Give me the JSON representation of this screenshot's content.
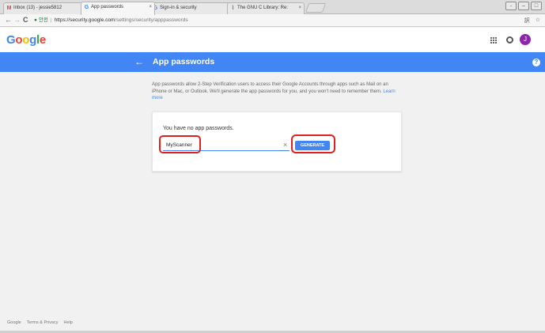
{
  "browser": {
    "tabs": [
      {
        "favicon": "M",
        "favicon_color": "#db4437",
        "title": "Inbox (13) - jessie5812",
        "active": false
      },
      {
        "favicon": "G",
        "favicon_color": "#4285f4",
        "title": "App passwords",
        "active": true
      },
      {
        "favicon": "G",
        "favicon_color": "#4285f4",
        "title": "Sign-in & security",
        "active": false
      },
      {
        "favicon": "⌇",
        "favicon_color": "#777777",
        "title": "The GNU C Library: Re:",
        "active": false
      }
    ],
    "tab_close": "×",
    "window_controls": [
      "˗",
      "–",
      "□"
    ],
    "nav": {
      "back": "←",
      "forward": "→",
      "reload": "C"
    },
    "address": {
      "secure_text": "안전",
      "url_host": "https://security.google.com",
      "url_path": "/settings/security/apppasswords"
    },
    "toolbar_icons": [
      "translate-icon",
      "star-icon"
    ],
    "toolbar_glyphs": {
      "translate": "訳",
      "star": "☆"
    }
  },
  "header": {
    "logo": "Google",
    "logo_colors": [
      "#4285f4",
      "#ea4335",
      "#fbbc05",
      "#4285f4",
      "#34a853",
      "#ea4335"
    ],
    "avatar_letter": "J",
    "avatar_color": "#8e24aa"
  },
  "titlebar": {
    "title": "App passwords",
    "back_glyph": "←",
    "help_glyph": "?",
    "color": "#4285f4"
  },
  "main": {
    "description": "App passwords allow 2-Step Verification users to access their Google Accounts through apps such as Mail on an iPhone or Mac, or Outlook. We'll generate the app passwords for you, and you won't need to remember them.",
    "learn_more": "Learn more",
    "card": {
      "empty_message": "You have no app passwords.",
      "input_value": "MyScanner",
      "clear_glyph": "×",
      "generate_label": "GENERATE"
    },
    "highlight_color": "#e0201f"
  },
  "footer": {
    "links": [
      "Google",
      "Terms & Privacy",
      "Help"
    ]
  }
}
